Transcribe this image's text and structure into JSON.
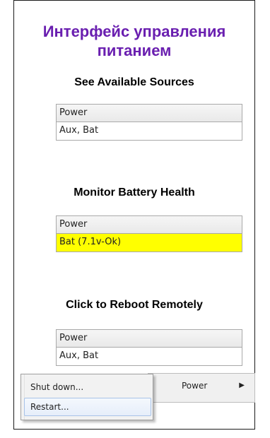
{
  "title": "Интерфейс управления питанием",
  "sections": [
    {
      "heading": "See Available Sources",
      "column_header": "Power",
      "value": "Aux, Bat"
    },
    {
      "heading": "Monitor Battery Health",
      "column_header": "Power",
      "value": "Bat (7.1v-Ok)",
      "value_highlight": "#ffff00"
    },
    {
      "heading": "Click to Reboot Remotely",
      "column_header": "Power",
      "value": "Aux, Bat"
    }
  ],
  "context_menu": {
    "parent_item": "Power",
    "items": [
      "Shut down...",
      "Restart..."
    ],
    "hovered_item": "Restart..."
  },
  "colors": {
    "title": "#6a1fb0",
    "highlight": "#ffff00"
  }
}
